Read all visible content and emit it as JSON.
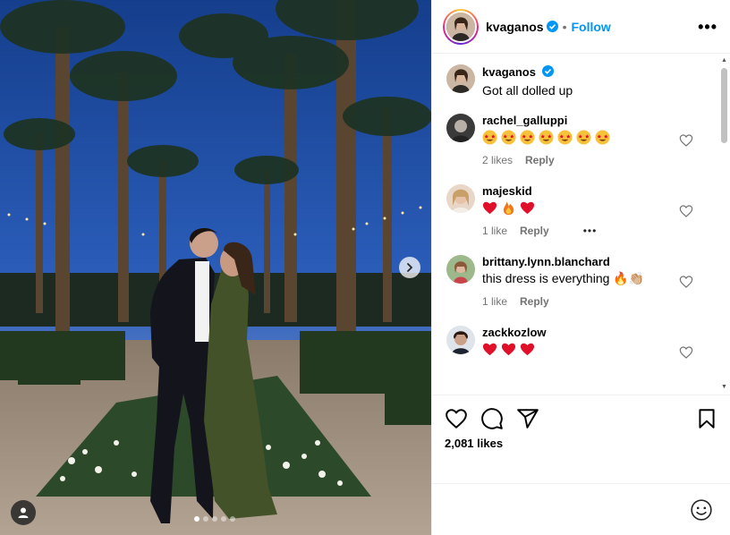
{
  "post": {
    "username": "kvaganos",
    "follow_label": "Follow",
    "separator": "•",
    "more_label": "•••",
    "caption": {
      "username": "kvaganos",
      "text": "Got all dolled up"
    },
    "comments": [
      {
        "username": "rachel_galluppi",
        "emoji_text": "🤩🤩🤩🤩🤩🤩🤩",
        "emoji_count": 7,
        "emoji": "star-struck",
        "likes": "2 likes",
        "reply": "Reply"
      },
      {
        "username": "majeskid",
        "emoji_text": "❤🔥❤",
        "emoji": "heart-fire-heart",
        "likes": "1 like",
        "reply": "Reply",
        "more": "•••"
      },
      {
        "username": "brittany.lynn.blanchard",
        "text": "this dress is everything 🔥👏🏼",
        "likes": "1 like",
        "reply": "Reply"
      },
      {
        "username": "zackkozlow",
        "emoji_text": "❤❤❤",
        "emoji": "hearts"
      }
    ],
    "likes_count": "2,081 likes",
    "add_comment_placeholder": ""
  },
  "colors": {
    "accent": "#0095f6",
    "heart": "#e0102a",
    "muted": "#737373"
  },
  "icons": [
    "verified-badge-icon",
    "heart-icon",
    "comment-icon",
    "share-icon",
    "bookmark-icon",
    "emoji-icon",
    "chevron-right-icon",
    "user-tag-icon"
  ],
  "carousel": {
    "count": 5,
    "active": 1
  }
}
